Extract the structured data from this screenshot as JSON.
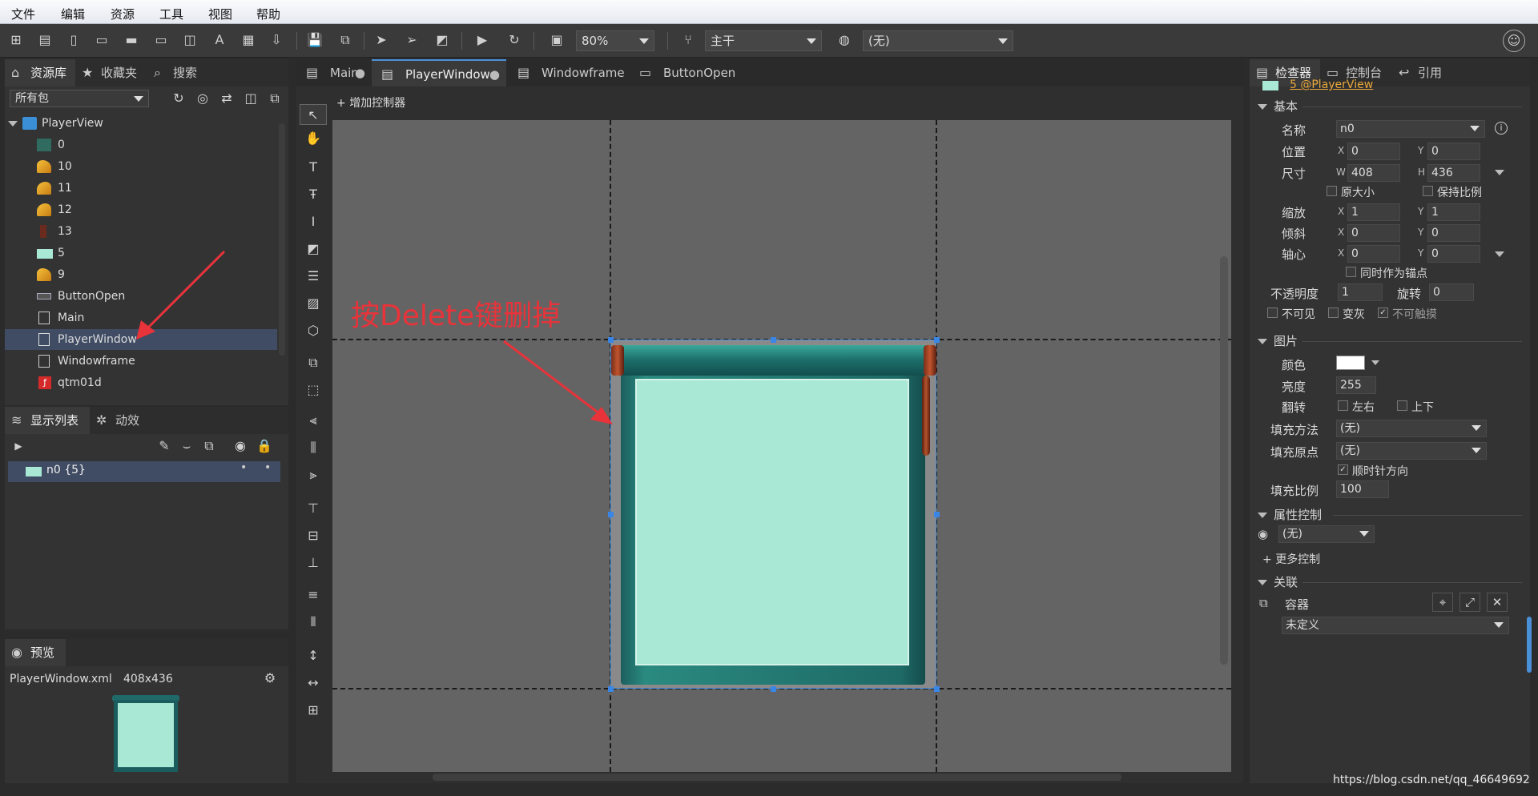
{
  "menu": [
    "文件",
    "编辑",
    "资源",
    "工具",
    "视图",
    "帮助"
  ],
  "toolbar": {
    "zoom": "80%",
    "branch": "主干",
    "lang": "(无)"
  },
  "left": {
    "tabs": [
      "资源库",
      "收藏夹",
      "搜索"
    ],
    "package": "所有包",
    "tree_root": "PlayerView",
    "tree_items": [
      "0",
      "10",
      "11",
      "12",
      "13",
      "5",
      "9",
      "ButtonOpen",
      "Main",
      "PlayerWindow",
      "Windowframe",
      "qtm01d"
    ],
    "display_tabs": [
      "显示列表",
      "动效"
    ],
    "display_item": "n0 {5}",
    "preview_tab": "预览",
    "preview_file": "PlayerWindow.xml",
    "preview_size": "408x436"
  },
  "center": {
    "doc_tabs": [
      "Main",
      "PlayerWindow",
      "Windowframe",
      "ButtonOpen"
    ],
    "add_controller": "增加控制器",
    "annotation": "按Delete键删掉"
  },
  "inspector": {
    "tabs": [
      "检查器",
      "控制台",
      "引用"
    ],
    "ref": "5 @PlayerView",
    "sec_basic": "基本",
    "name_label": "名称",
    "name_value": "n0",
    "pos_label": "位置",
    "pos_x": "0",
    "pos_y": "0",
    "size_label": "尺寸",
    "size_w": "408",
    "size_h": "436",
    "orig_size": "原大小",
    "keep_ratio": "保持比例",
    "scale_label": "缩放",
    "scale_x": "1",
    "scale_y": "1",
    "skew_label": "倾斜",
    "skew_x": "0",
    "skew_y": "0",
    "pivot_label": "轴心",
    "pivot_x": "0",
    "pivot_y": "0",
    "as_anchor": "同时作为锚点",
    "alpha_label": "不透明度",
    "alpha": "1",
    "rot_label": "旋转",
    "rot": "0",
    "invisible": "不可见",
    "gray": "变灰",
    "untouchable": "不可触摸",
    "sec_image": "图片",
    "color_label": "颜色",
    "brightness_label": "亮度",
    "brightness": "255",
    "flip_label": "翻转",
    "flip_h": "左右",
    "flip_v": "上下",
    "fill_method_label": "填充方法",
    "fill_method": "(无)",
    "fill_origin_label": "填充原点",
    "fill_origin": "(无)",
    "clockwise": "顺时针方向",
    "fill_amount_label": "填充比例",
    "fill_amount": "100",
    "sec_prop": "属性控制",
    "prop_ctrl": "(无)",
    "more_ctrl": "更多控制",
    "sec_rel": "关联",
    "container": "容器",
    "undefined": "未定义"
  },
  "watermark": "https://blog.csdn.net/qq_46649692",
  "colors": {
    "accent": "#4a90d9",
    "annotation": "#e8333a",
    "panel_bg": "#333333",
    "canvas": "#646464"
  }
}
